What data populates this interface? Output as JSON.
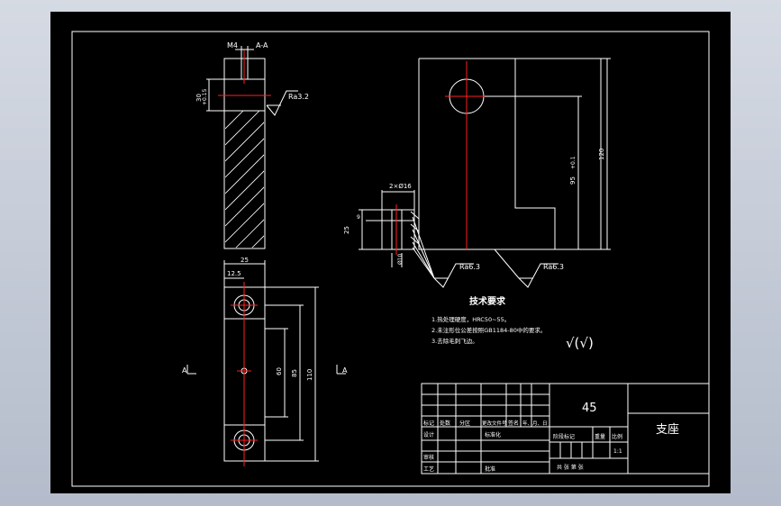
{
  "section": {
    "label": "A-A",
    "dim_width_top": "M4",
    "dim_height": "30",
    "dim_height_tol": "+0.15",
    "roughness": "Ra3.2"
  },
  "bottom_view": {
    "dim_width": "25",
    "dim_half": "12.5",
    "dim_60": "60",
    "dim_85": "85",
    "dim_110": "110",
    "cut_left": "A",
    "cut_right": "A"
  },
  "front_view": {
    "hole_label": "2×Ø16",
    "dim_9": "9",
    "dim_25": "25",
    "dim_d10": "Ø10",
    "dim_95": "95",
    "dim_95_tol": "+0.1",
    "dim_120": "120",
    "roughness_left": "Ra6.3",
    "roughness_right": "Ra6.3"
  },
  "notes": {
    "title": "技术要求",
    "items": [
      "1.热处理硬度，HRC50~55。",
      "2.未注形位公差按照GB1184-80中的要求。",
      "3.去除毛刺飞边。"
    ],
    "finish_symbol": "√(√)"
  },
  "title_block": {
    "material": "45",
    "part_name": "支座",
    "header_cells": [
      "标记",
      "处数",
      "分区",
      "更改文件号",
      "签名",
      "年、月、日"
    ],
    "row_design": "设计",
    "row_standard": "标准化",
    "row_review": "审核",
    "row_process": "工艺",
    "row_approve": "批准",
    "stage_label": "阶段标记",
    "weight_label": "重量",
    "scale_label": "比例",
    "scale_value": "1:1",
    "sheet_labels": "共  张  第  张"
  }
}
